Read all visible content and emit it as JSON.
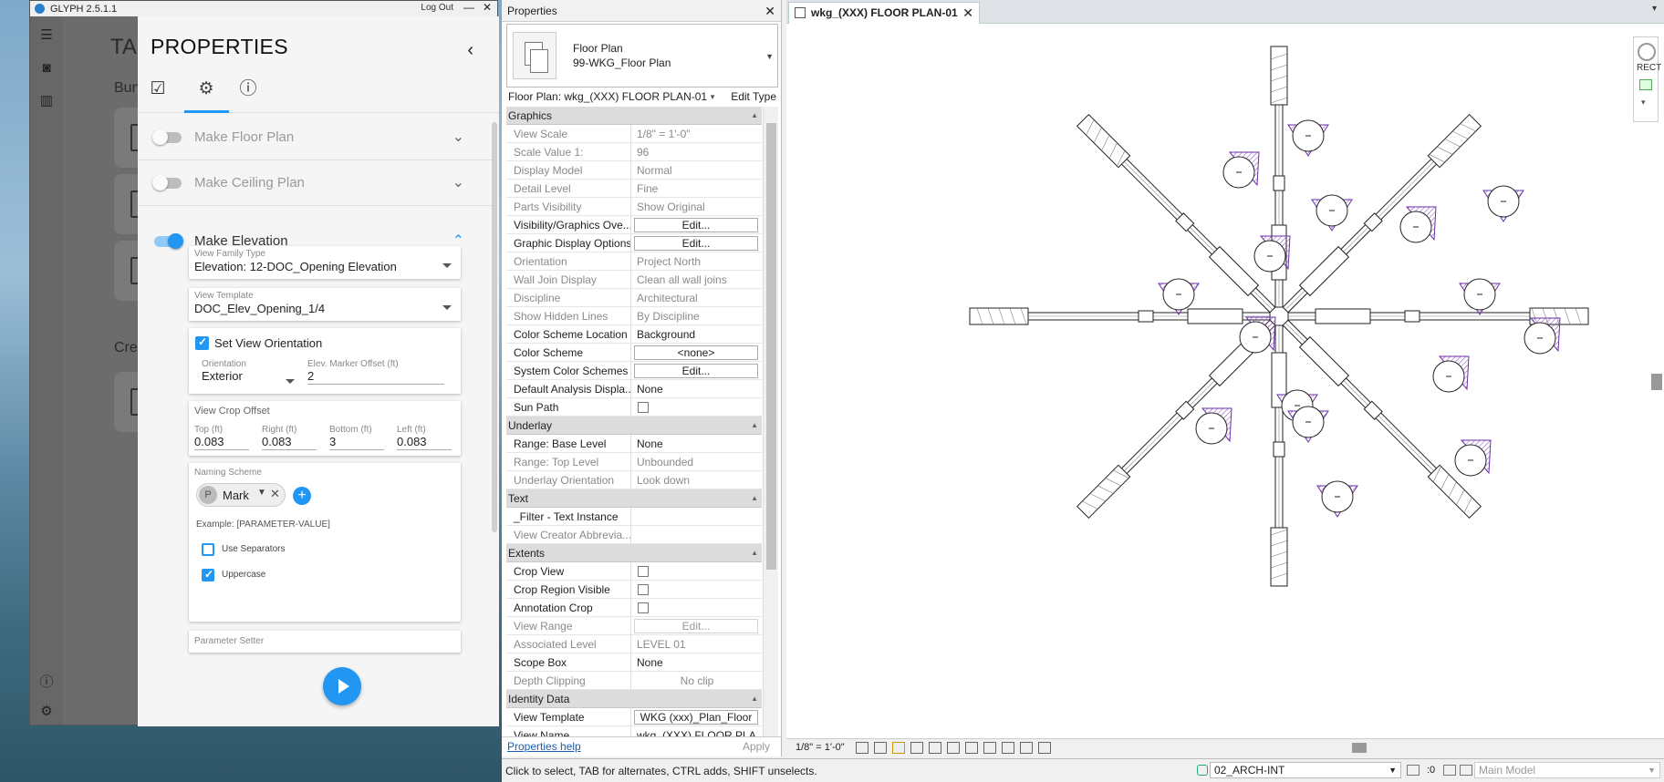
{
  "glyph": {
    "title": "GLYPH 2.5.1.1",
    "logout": "Log Out",
    "minimize": "—",
    "close": "✕",
    "tasks_title": "TASKS",
    "bundle_label": "Bundle",
    "create_label": "Create",
    "properties": {
      "title": "PROPERTIES",
      "back": "‹",
      "tabs": {
        "tasks_icon": "checklist-icon",
        "settings_icon": "gear-icon",
        "info_icon": "info-icon"
      },
      "sections": {
        "floor_plan": {
          "label": "Make Floor Plan",
          "enabled": false
        },
        "ceiling_plan": {
          "label": "Make Ceiling Plan",
          "enabled": false
        },
        "elevation": {
          "label": "Make Elevation",
          "enabled": true
        }
      },
      "view_family_type": {
        "label": "View Family Type",
        "value": "Elevation: 12-DOC_Opening Elevation"
      },
      "view_template": {
        "label": "View Template",
        "value": "DOC_Elev_Opening_1/4"
      },
      "orientation_box": {
        "set_view_orientation": "Set View Orientation",
        "set_view_orientation_checked": true,
        "orientation_label": "Orientation",
        "orientation_value": "Exterior",
        "offset_label": "Elev. Marker Offset (ft)",
        "offset_value": "2"
      },
      "crop_offset": {
        "title": "View Crop Offset",
        "top_label": "Top (ft)",
        "top_value": "0.083",
        "right_label": "Right (ft)",
        "right_value": "0.083",
        "bottom_label": "Bottom (ft)",
        "bottom_value": "3",
        "left_label": "Left (ft)",
        "left_value": "0.083"
      },
      "naming": {
        "title": "Naming Scheme",
        "chip_avatar": "P",
        "chip_label": "Mark",
        "example": "Example: [PARAMETER-VALUE]",
        "use_separators": "Use Separators",
        "use_separators_checked": false,
        "uppercase": "Uppercase",
        "uppercase_checked": true
      },
      "parameter_setter": "Parameter Setter"
    }
  },
  "revit": {
    "properties_title": "Properties",
    "type_family": "Floor Plan",
    "type_name": "99-WKG_Floor Plan",
    "instance_selector": "Floor Plan: wkg_(XXX) FLOOR PLAN-01",
    "edit_type": "Edit Type",
    "groups": [
      {
        "name": "Graphics",
        "rows": [
          {
            "name": "View Scale",
            "value": "1/8\" = 1'-0\"",
            "dim": true
          },
          {
            "name": "Scale Value    1:",
            "value": "96",
            "dim": true
          },
          {
            "name": "Display Model",
            "value": "Normal",
            "dim": true
          },
          {
            "name": "Detail Level",
            "value": "Fine",
            "dim": true
          },
          {
            "name": "Parts Visibility",
            "value": "Show Original",
            "dim": true
          },
          {
            "name": "Visibility/Graphics Ove...",
            "button": "Edit..."
          },
          {
            "name": "Graphic Display Options",
            "button": "Edit..."
          },
          {
            "name": "Orientation",
            "value": "Project North",
            "dim": true
          },
          {
            "name": "Wall Join Display",
            "value": "Clean all wall joins",
            "dim": true
          },
          {
            "name": "Discipline",
            "value": "Architectural",
            "dim": true
          },
          {
            "name": "Show Hidden Lines",
            "value": "By Discipline",
            "dim": true
          },
          {
            "name": "Color Scheme Location",
            "value": "Background"
          },
          {
            "name": "Color Scheme",
            "button": "<none>"
          },
          {
            "name": "System Color Schemes",
            "button": "Edit..."
          },
          {
            "name": "Default Analysis Displa...",
            "value": "None"
          },
          {
            "name": "Sun Path",
            "checkbox": false
          }
        ]
      },
      {
        "name": "Underlay",
        "rows": [
          {
            "name": "Range: Base Level",
            "value": "None"
          },
          {
            "name": "Range: Top Level",
            "value": "Unbounded",
            "dim": true
          },
          {
            "name": "Underlay Orientation",
            "value": "Look down",
            "dim": true
          }
        ]
      },
      {
        "name": "Text",
        "rows": [
          {
            "name": "_Filter - Text Instance",
            "value": ""
          },
          {
            "name": "View Creator Abbrevia...",
            "value": "",
            "dim": true
          }
        ]
      },
      {
        "name": "Extents",
        "rows": [
          {
            "name": "Crop View",
            "checkbox": false
          },
          {
            "name": "Crop Region Visible",
            "checkbox": false
          },
          {
            "name": "Annotation Crop",
            "checkbox": false
          },
          {
            "name": "View Range",
            "button": "Edit...",
            "dim": true
          },
          {
            "name": "Associated Level",
            "value": "LEVEL 01",
            "dim": true
          },
          {
            "name": "Scope Box",
            "value": "None"
          },
          {
            "name": "Depth Clipping",
            "value": "No clip",
            "dim": true,
            "centered": true
          }
        ]
      },
      {
        "name": "Identity Data",
        "rows": [
          {
            "name": "View Template",
            "button": "WKG (xxx)_Plan_Floor"
          },
          {
            "name": "View Name",
            "value": "wkg_(XXX) FLOOR PLA..."
          }
        ]
      }
    ],
    "properties_help": "Properties help",
    "apply": "Apply",
    "view_tab": "wkg_(XXX) FLOOR PLAN-01",
    "nav_label": "RECT",
    "view_scale": "1/8\" = 1'-0\"",
    "status_message": "Click to select, TAB for alternates, CTRL adds, SHIFT unselects.",
    "workset": "02_ARCH-INT",
    "filter_count": ":0",
    "main_model": "Main Model"
  }
}
